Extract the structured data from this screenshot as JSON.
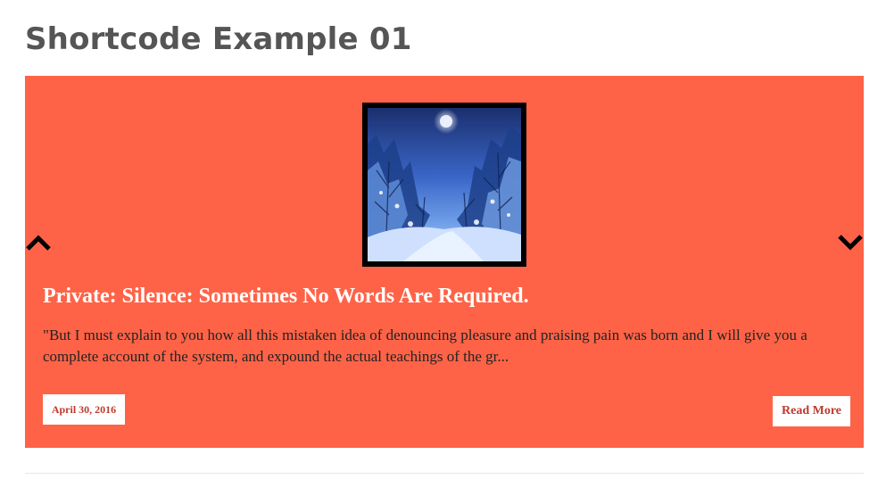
{
  "page": {
    "title": "Shortcode Example 01"
  },
  "slider": {
    "background": "#ff6347",
    "prev_icon": "chevron-up-icon",
    "next_icon": "chevron-down-icon",
    "post": {
      "title": "Private: Silence: Sometimes No Words Are Required.",
      "excerpt": "\"But I must explain to you how all this mistaken idea of denouncing pleasure and praising pain was born and I will give you a complete account of the system, and expound the actual teachings of the gr...",
      "date": "April 30, 2016",
      "read_more_label": "Read More",
      "accent": "#c0392b"
    }
  }
}
